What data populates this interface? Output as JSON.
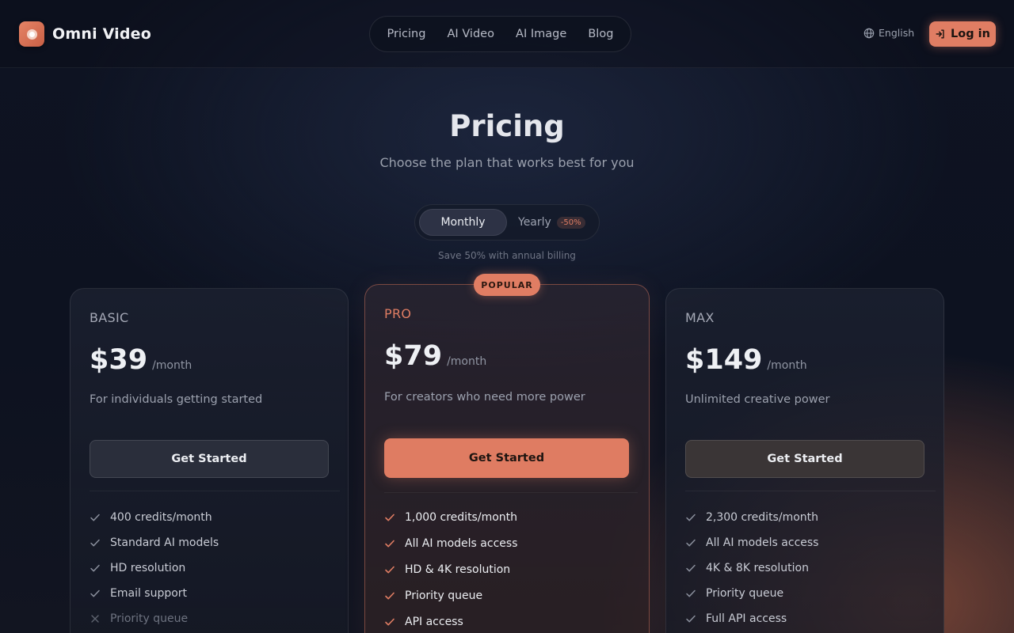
{
  "brand": {
    "name": "Omni Video",
    "logo_icon": "record-icon",
    "accent": "#e07d63"
  },
  "nav": {
    "items": [
      "Pricing",
      "AI Video",
      "AI Image",
      "Blog"
    ]
  },
  "header": {
    "language": "English",
    "login_label": "Log in"
  },
  "hero": {
    "title": "Pricing",
    "subtitle": "Choose the plan that works best for you"
  },
  "billing": {
    "monthly_label": "Monthly",
    "yearly_label": "Yearly",
    "yearly_discount": "-50%",
    "selected": "Monthly",
    "note": "Save 50% with annual billing"
  },
  "plans": [
    {
      "name": "BASIC",
      "price": "$39",
      "period": "/month",
      "description": "For individuals getting started",
      "cta": "Get Started",
      "features": [
        {
          "text": "400 credits/month",
          "included": true
        },
        {
          "text": "Standard AI models",
          "included": true
        },
        {
          "text": "HD resolution",
          "included": true
        },
        {
          "text": "Email support",
          "included": true
        },
        {
          "text": "Priority queue",
          "included": false
        }
      ]
    },
    {
      "name": "PRO",
      "price": "$79",
      "period": "/month",
      "description": "For creators who need more power",
      "cta": "Get Started",
      "badge": "POPULAR",
      "features": [
        {
          "text": "1,000 credits/month",
          "included": true
        },
        {
          "text": "All AI models access",
          "included": true
        },
        {
          "text": "HD & 4K resolution",
          "included": true
        },
        {
          "text": "Priority queue",
          "included": true
        },
        {
          "text": "API access",
          "included": true
        }
      ]
    },
    {
      "name": "MAX",
      "price": "$149",
      "period": "/month",
      "description": "Unlimited creative power",
      "cta": "Get Started",
      "features": [
        {
          "text": "2,300 credits/month",
          "included": true
        },
        {
          "text": "All AI models access",
          "included": true
        },
        {
          "text": "4K & 8K resolution",
          "included": true
        },
        {
          "text": "Priority queue",
          "included": true
        },
        {
          "text": "Full API access",
          "included": true
        }
      ]
    }
  ]
}
